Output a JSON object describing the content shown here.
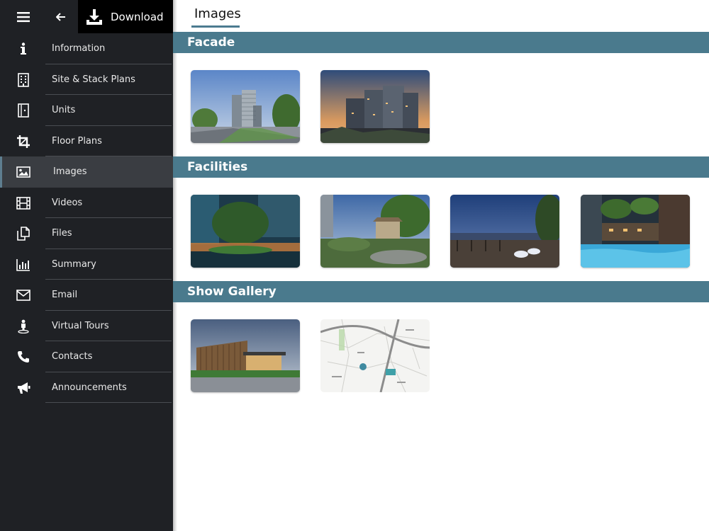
{
  "topbar": {
    "download_label": "Download"
  },
  "nav": {
    "items": [
      {
        "label": "Information",
        "icon": "info-icon"
      },
      {
        "label": "Site & Stack Plans",
        "icon": "building-icon"
      },
      {
        "label": "Units",
        "icon": "door-icon"
      },
      {
        "label": "Floor Plans",
        "icon": "crop-icon"
      },
      {
        "label": "Images",
        "icon": "image-icon",
        "active": true
      },
      {
        "label": "Videos",
        "icon": "film-icon"
      },
      {
        "label": "Files",
        "icon": "files-icon"
      },
      {
        "label": "Summary",
        "icon": "bar-chart-icon"
      },
      {
        "label": "Email",
        "icon": "envelope-icon"
      },
      {
        "label": "Virtual Tours",
        "icon": "street-view-icon"
      },
      {
        "label": "Contacts",
        "icon": "phone-icon"
      },
      {
        "label": "Announcements",
        "icon": "megaphone-icon"
      }
    ]
  },
  "main": {
    "title": "Images",
    "sections": [
      {
        "title": "Facade",
        "images": [
          "facade-render-1",
          "facade-render-2"
        ]
      },
      {
        "title": "Facilities",
        "images": [
          "facility-render-1",
          "facility-render-2",
          "facility-render-3",
          "facility-render-4"
        ]
      },
      {
        "title": "Show Gallery",
        "images": [
          "show-gallery-render",
          "location-map"
        ]
      }
    ]
  },
  "colors": {
    "sidebar_bg": "#1f2125",
    "sidebar_active": "#3a3d42",
    "download_bg": "#000000",
    "section_header": "#4a7a8d",
    "title_underline": "#4c7b90"
  }
}
